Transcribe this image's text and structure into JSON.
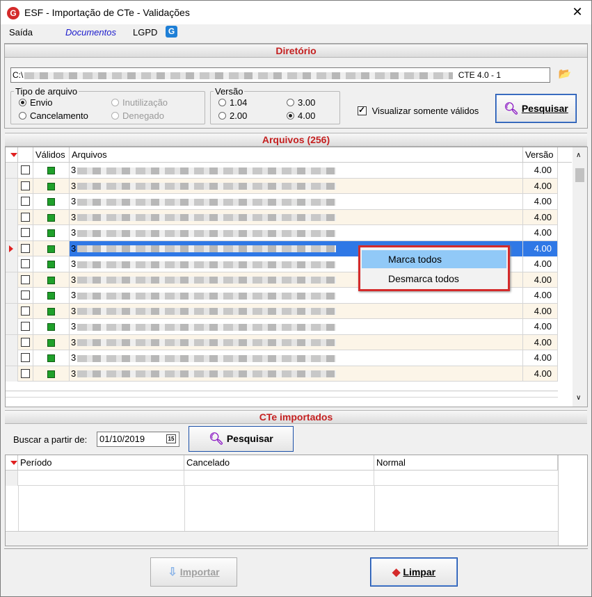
{
  "window": {
    "title": "ESF - Importação de CTe - Validações",
    "logo_letter": "G",
    "close_glyph": "✕"
  },
  "menu": {
    "items": [
      "Saída",
      "Documentos",
      "LGPD"
    ],
    "lgpd_icon_letter": "G"
  },
  "diretorio": {
    "header": "Diretório",
    "path_prefix": "C:\\",
    "path_suffix": "CTE 4.0 - 1",
    "tipo_arquivo": {
      "legend": "Tipo de arquivo",
      "options": [
        {
          "label": "Envio",
          "checked": true,
          "enabled": true
        },
        {
          "label": "Cancelamento",
          "checked": false,
          "enabled": true
        },
        {
          "label": "Inutilização",
          "checked": false,
          "enabled": false
        },
        {
          "label": "Denegado",
          "checked": false,
          "enabled": false
        }
      ]
    },
    "versao": {
      "legend": "Versão",
      "options": [
        {
          "label": "1.04",
          "checked": false
        },
        {
          "label": "2.00",
          "checked": false
        },
        {
          "label": "3.00",
          "checked": false
        },
        {
          "label": "4.00",
          "checked": true
        }
      ]
    },
    "somente_validos": {
      "label": "Visualizar somente válidos",
      "checked": true
    },
    "pesquisar_label": "Pesquisar"
  },
  "arquivos": {
    "header": "Arquivos (256)",
    "columns": [
      "Válidos",
      "Arquivos",
      "Versão"
    ],
    "rows": [
      {
        "prefix": "3",
        "versao": "4.00"
      },
      {
        "prefix": "3",
        "versao": "4.00"
      },
      {
        "prefix": "3",
        "versao": "4.00"
      },
      {
        "prefix": "3",
        "versao": "4.00"
      },
      {
        "prefix": "3",
        "versao": "4.00"
      },
      {
        "prefix": "3",
        "versao": "4.00"
      },
      {
        "prefix": "3",
        "versao": "4.00"
      },
      {
        "prefix": "3",
        "versao": "4.00"
      },
      {
        "prefix": "3",
        "versao": "4.00"
      },
      {
        "prefix": "3",
        "versao": "4.00"
      },
      {
        "prefix": "3",
        "versao": "4.00"
      },
      {
        "prefix": "3",
        "versao": "4.00"
      },
      {
        "prefix": "3",
        "versao": "4.00"
      },
      {
        "prefix": "3",
        "versao": "4.00"
      }
    ],
    "selected_row": 5,
    "context_menu": [
      "Marca todos",
      "Desmarca todos"
    ]
  },
  "cte_importados": {
    "header": "CTe importados",
    "buscar_label": "Buscar a partir de:",
    "buscar_date": "01/10/2019",
    "calendar_glyph": "15",
    "pesquisar_label": "Pesquisar",
    "columns": [
      "Período",
      "Cancelado",
      "Normal"
    ]
  },
  "footer": {
    "importar_label": "Importar",
    "limpar_label": "Limpar"
  },
  "colors": {
    "accent_red": "#c42020",
    "selection_blue": "#2f78e6",
    "search_purple": "#8b17c4"
  }
}
